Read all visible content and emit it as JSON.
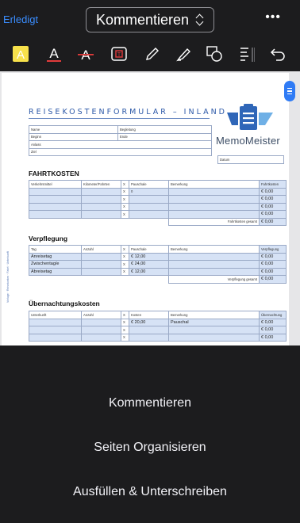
{
  "topbar": {
    "done_label": "Erledigt",
    "mode_label": "Kommentieren",
    "more_label": "•••"
  },
  "toolbar": {
    "tools": [
      "highlight-icon",
      "text-color-icon",
      "strikethrough-icon",
      "textbox-icon",
      "pencil-icon",
      "marker-icon",
      "shapes-icon",
      "list-icon",
      "undo-icon"
    ],
    "accent_color": "#f7e14b",
    "red_color": "#e23b3b"
  },
  "document": {
    "title": "REISEKOSTENFORMULAR – INLAND",
    "logo_text": "MemoMeister",
    "header_fields": {
      "name": "Name",
      "beginn": "Beginn",
      "beginn_extra": "Begleitung",
      "ende": "Ende",
      "anlass": "Anlass",
      "ziel": "Ziel",
      "datum": "Datum"
    },
    "fahrtkosten": {
      "heading": "FAHRTKOSTEN",
      "columns": [
        "Verkehrsmittel",
        "Kilometer/Fahrten",
        "X",
        "Pauschale",
        "Bemerkung",
        "Fahrtkosten"
      ],
      "rows": [
        [
          "",
          "",
          "X",
          "0",
          "",
          "€ 0,00"
        ],
        [
          "",
          "",
          "X",
          "",
          "",
          "€ 0,00"
        ],
        [
          "",
          "",
          "X",
          "",
          "",
          "€ 0,00"
        ],
        [
          "",
          "",
          "X",
          "",
          "",
          "€ 0,00"
        ]
      ],
      "total_label": "Fahrtkosten gesamt",
      "total_value": "€ 0,00"
    },
    "verpflegung": {
      "heading": "Verpflegung",
      "columns": [
        "Tag",
        "Anzahl",
        "X",
        "Pauschale",
        "Bemerkung",
        "Verpflegung"
      ],
      "rows": [
        [
          "Anreisetag",
          "",
          "X",
          "€ 12,00",
          "",
          "€ 0,00"
        ],
        [
          "Zwischentag/e",
          "",
          "X",
          "€ 24,00",
          "",
          "€ 0,00"
        ],
        [
          "Abreisetag",
          "",
          "X",
          "€ 12,00",
          "",
          "€ 0,00"
        ]
      ],
      "total_label": "Verpflegung gesamt",
      "total_value": "€ 0,00"
    },
    "uebernachtung": {
      "heading": "Übernachtungskosten",
      "columns": [
        "Unterkunft",
        "Anzahl",
        "X",
        "Kosten",
        "Bemerkung",
        "Übernachtung"
      ],
      "rows": [
        [
          "",
          "",
          "X",
          "€ 20,00",
          "Pauschal",
          "€ 0,00"
        ],
        [
          "",
          "",
          "X",
          "",
          "",
          "€ 0,00"
        ],
        [
          "",
          "",
          "X",
          "",
          "",
          "€ 0,00"
        ]
      ]
    },
    "margin_note": "Vorlage · Reisekosten · Fahrt · Unterkunft"
  },
  "sheet": {
    "items": [
      "Kommentieren",
      "Seiten Organisieren",
      "Ausfüllen & Unterschreiben"
    ]
  }
}
